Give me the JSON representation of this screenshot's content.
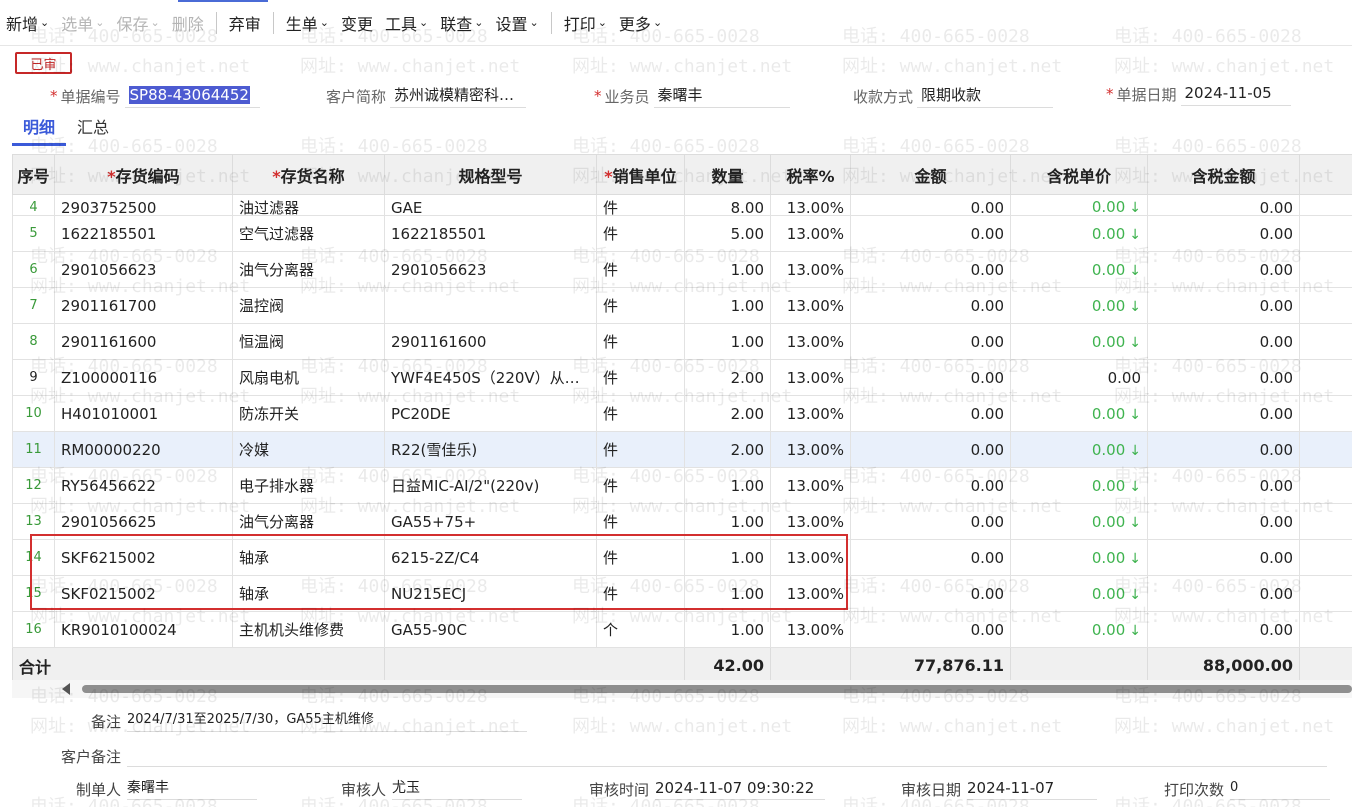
{
  "toolbar": {
    "items": [
      {
        "label": "新增",
        "chevron": true,
        "disabled": false
      },
      {
        "label": "选单",
        "chevron": true,
        "disabled": true
      },
      {
        "label": "保存",
        "chevron": true,
        "disabled": true
      },
      {
        "label": "删除",
        "chevron": false,
        "disabled": true
      },
      {
        "label": "弃审",
        "chevron": false,
        "disabled": false
      },
      {
        "label": "生单",
        "chevron": true,
        "disabled": false
      },
      {
        "label": "变更",
        "chevron": false,
        "disabled": false
      },
      {
        "label": "工具",
        "chevron": true,
        "disabled": false
      },
      {
        "label": "联查",
        "chevron": true,
        "disabled": false
      },
      {
        "label": "设置",
        "chevron": true,
        "disabled": false
      },
      {
        "label": "打印",
        "chevron": true,
        "disabled": false
      },
      {
        "label": "更多",
        "chevron": true,
        "disabled": false
      }
    ]
  },
  "status_badge": "已审",
  "header": {
    "doc_no_label": "单据编号",
    "doc_no": "SP88-43064452",
    "customer_label": "客户简称",
    "customer": "苏州诚模精密科…",
    "salesman_label": "业务员",
    "salesman": "秦曙丰",
    "payment_label": "收款方式",
    "payment": "限期收款",
    "date_label": "单据日期",
    "date": "2024-11-05"
  },
  "tabs": [
    "明细",
    "汇总"
  ],
  "table": {
    "columns": [
      "序号",
      "存货编码",
      "存货名称",
      "规格型号",
      "销售单位",
      "数量",
      "税率%",
      "金额",
      "含税单价",
      "含税金额"
    ],
    "required_cols": [
      1,
      2,
      4
    ],
    "rows": [
      {
        "seq": "4",
        "code": "2903752500",
        "name": "油过滤器",
        "spec": "GAE",
        "unit": "件",
        "qty": "8.00",
        "tax": "13.00%",
        "amount": "0.00",
        "price": "0.00",
        "price_arrow": true,
        "total": "0.00"
      },
      {
        "seq": "5",
        "code": "1622185501",
        "name": "空气过滤器",
        "spec": "1622185501",
        "unit": "件",
        "qty": "5.00",
        "tax": "13.00%",
        "amount": "0.00",
        "price": "0.00",
        "price_arrow": true,
        "total": "0.00"
      },
      {
        "seq": "6",
        "code": "2901056623",
        "name": "油气分离器",
        "spec": "2901056623",
        "unit": "件",
        "qty": "1.00",
        "tax": "13.00%",
        "amount": "0.00",
        "price": "0.00",
        "price_arrow": true,
        "total": "0.00"
      },
      {
        "seq": "7",
        "code": "2901161700",
        "name": "温控阀",
        "spec": "",
        "unit": "件",
        "qty": "1.00",
        "tax": "13.00%",
        "amount": "0.00",
        "price": "0.00",
        "price_arrow": true,
        "total": "0.00"
      },
      {
        "seq": "8",
        "code": "2901161600",
        "name": "恒温阀",
        "spec": "2901161600",
        "unit": "件",
        "qty": "1.00",
        "tax": "13.00%",
        "amount": "0.00",
        "price": "0.00",
        "price_arrow": true,
        "total": "0.00"
      },
      {
        "seq": "9",
        "code": "Z100000116",
        "name": "风扇电机",
        "spec": "YWF4E450S（220V）从…",
        "unit": "件",
        "qty": "2.00",
        "tax": "13.00%",
        "amount": "0.00",
        "price": "0.00",
        "price_arrow": false,
        "total": "0.00"
      },
      {
        "seq": "10",
        "code": "H401010001",
        "name": "防冻开关",
        "spec": "PC20DE",
        "unit": "件",
        "qty": "2.00",
        "tax": "13.00%",
        "amount": "0.00",
        "price": "0.00",
        "price_arrow": true,
        "total": "0.00"
      },
      {
        "seq": "11",
        "code": "RM00000220",
        "name": "冷媒",
        "spec": "R22(雪佳乐)",
        "unit": "件",
        "qty": "2.00",
        "tax": "13.00%",
        "amount": "0.00",
        "price": "0.00",
        "price_arrow": true,
        "total": "0.00"
      },
      {
        "seq": "12",
        "code": "RY56456622",
        "name": "电子排水器",
        "spec": "日益MIC-AI/2\"(220v)",
        "unit": "件",
        "qty": "1.00",
        "tax": "13.00%",
        "amount": "0.00",
        "price": "0.00",
        "price_arrow": true,
        "total": "0.00"
      },
      {
        "seq": "13",
        "code": "2901056625",
        "name": "油气分离器",
        "spec": "GA55+75+",
        "unit": "件",
        "qty": "1.00",
        "tax": "13.00%",
        "amount": "0.00",
        "price": "0.00",
        "price_arrow": true,
        "total": "0.00"
      },
      {
        "seq": "14",
        "code": "SKF6215002",
        "name": "轴承",
        "spec": "6215-2Z/C4",
        "unit": "件",
        "qty": "1.00",
        "tax": "13.00%",
        "amount": "0.00",
        "price": "0.00",
        "price_arrow": true,
        "total": "0.00"
      },
      {
        "seq": "15",
        "code": "SKF0215002",
        "name": "轴承",
        "spec": "NU215ECJ",
        "unit": "件",
        "qty": "1.00",
        "tax": "13.00%",
        "amount": "0.00",
        "price": "0.00",
        "price_arrow": true,
        "total": "0.00"
      },
      {
        "seq": "16",
        "code": "KR9010100024",
        "name": "主机机头维修费",
        "spec": "GA55-90C",
        "unit": "个",
        "qty": "1.00",
        "tax": "13.00%",
        "amount": "0.00",
        "price": "0.00",
        "price_arrow": true,
        "total": "0.00"
      }
    ],
    "totals": {
      "label": "合计",
      "qty": "42.00",
      "amount": "77,876.11",
      "total": "88,000.00"
    }
  },
  "footer": {
    "remark_label": "备注",
    "remark": "2024/7/31至2025/7/30，GA55主机维修",
    "customer_remark_label": "客户备注",
    "customer_remark": "",
    "maker_label": "制单人",
    "maker": "秦曙丰",
    "auditor_label": "审核人",
    "auditor": "尤玉",
    "audit_time_label": "审核时间",
    "audit_time": "2024-11-07 09:30:22",
    "audit_date_label": "审核日期",
    "audit_date": "2024-11-07",
    "print_count_label": "打印次数",
    "print_count": "0"
  },
  "watermark": {
    "phone": "电话: 400-665-0028",
    "site": "网址: www.chanjet.net"
  },
  "colors": {
    "accent": "#3b5ad9",
    "required": "#d32f2f",
    "green": "#3fb34f",
    "badge": "#c62828"
  }
}
